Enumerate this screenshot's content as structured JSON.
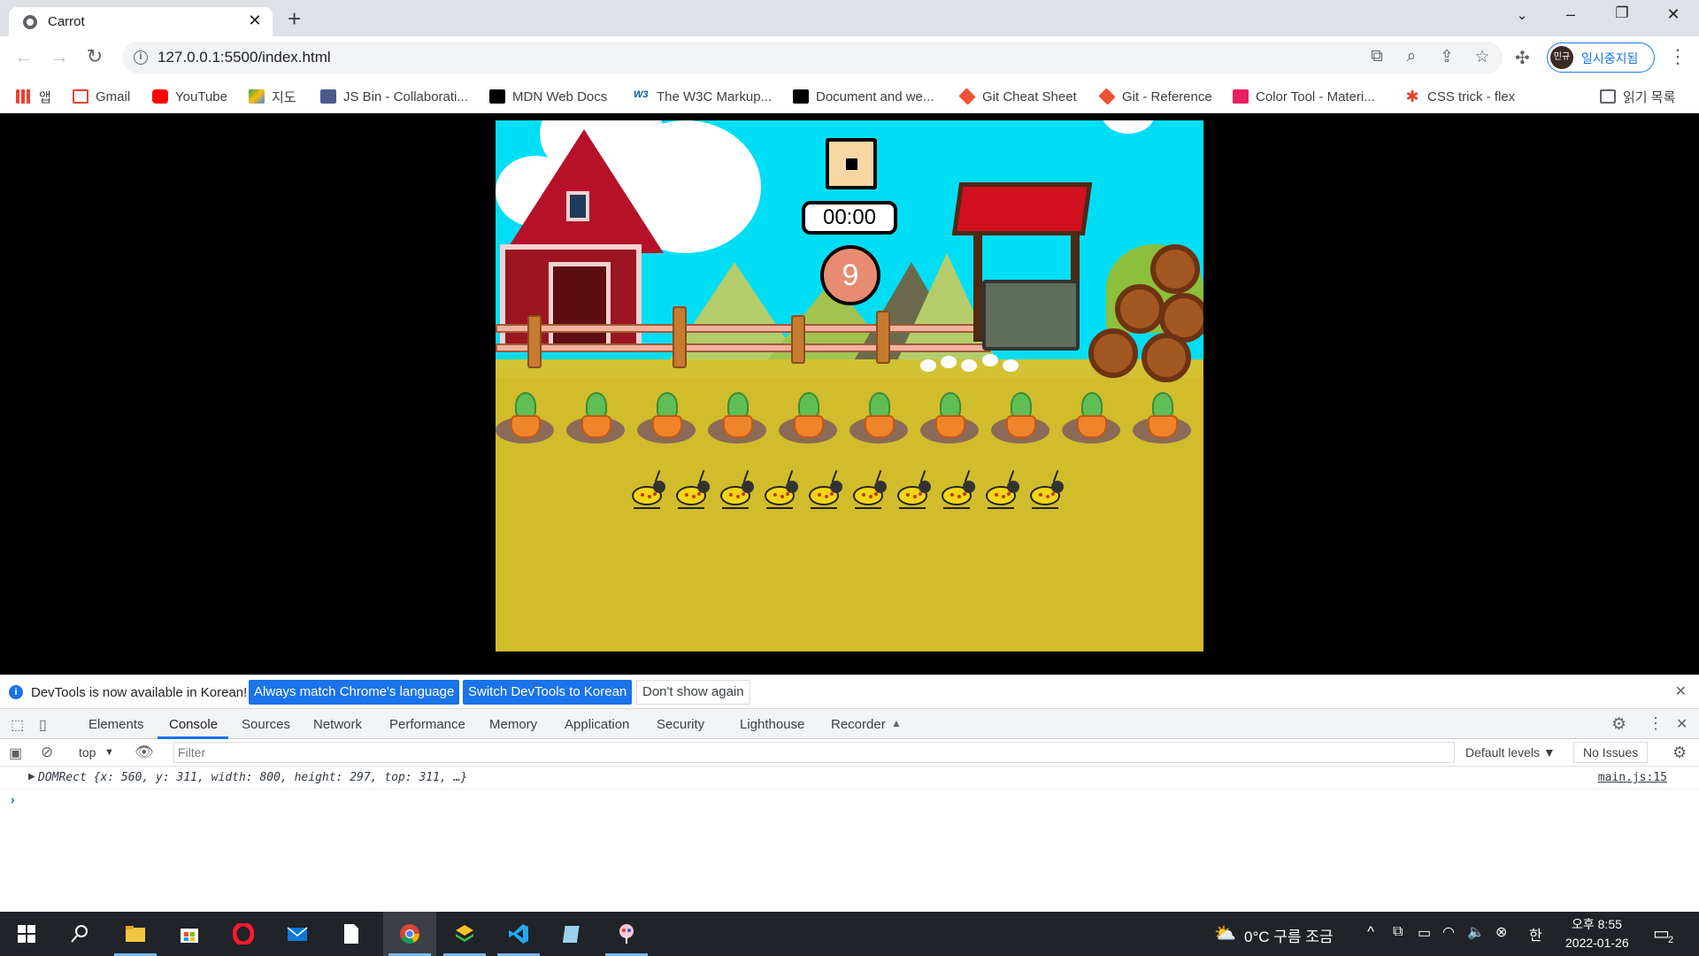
{
  "browser": {
    "tab_title": "Carrot",
    "tab_close": "✕",
    "new_tab": "+",
    "url": "127.0.0.1:5500/index.html",
    "profile_label": "일시중지됨",
    "profile_avatar": "민규"
  },
  "bookmarks": [
    {
      "label": "앱",
      "icon": "apps-grid-icon",
      "color": "#ea4335"
    },
    {
      "label": "Gmail",
      "icon": "gmail-icon",
      "color": "#ea4335"
    },
    {
      "label": "YouTube",
      "icon": "youtube-icon",
      "color": "#ff0000"
    },
    {
      "label": "지도",
      "icon": "maps-icon",
      "color": "#34a853"
    },
    {
      "label": "JS Bin - Collaborati...",
      "icon": "jsbin-icon",
      "color": "#4a5a8c"
    },
    {
      "label": "MDN Web Docs",
      "icon": "mdn-icon",
      "color": "#000000"
    },
    {
      "label": "The W3C Markup...",
      "icon": "w3c-icon",
      "color": "#005a9c"
    },
    {
      "label": "Document and we...",
      "icon": "mdn-icon",
      "color": "#000000"
    },
    {
      "label": "Git Cheat Sheet",
      "icon": "git-icon",
      "color": "#f05033"
    },
    {
      "label": "Git - Reference",
      "icon": "git-icon",
      "color": "#f05033"
    },
    {
      "label": "Color Tool - Materi...",
      "icon": "color-tool-icon",
      "color": "#e91e63"
    },
    {
      "label": "CSS trick - flex",
      "icon": "css-tricks-icon",
      "color": "#e8412c"
    }
  ],
  "reading_list": "읽기 목록",
  "game": {
    "timer": "00:00",
    "score": "9",
    "carrot_count": 10,
    "bug_count": 10
  },
  "devtools": {
    "info_message": "DevTools is now available in Korean!",
    "btn_always_match": "Always match Chrome's language",
    "btn_switch": "Switch DevTools to Korean",
    "btn_dont_show": "Don't show again",
    "tabs": [
      "Elements",
      "Console",
      "Sources",
      "Network",
      "Performance",
      "Memory",
      "Application",
      "Security",
      "Lighthouse",
      "Recorder"
    ],
    "active_tab": "Console",
    "context": "top",
    "filter_placeholder": "Filter",
    "default_levels": "Default levels ▼",
    "no_issues": "No Issues",
    "log_text": "DOMRect {x: 560, y: 311, width: 800, height: 297, top: 311, …}",
    "log_source": "main.js:15"
  },
  "taskbar": {
    "weather": "0°C  구름 조금",
    "ime": "한",
    "time": "오후 8:55",
    "date": "2022-01-26",
    "notif_count": "2"
  }
}
